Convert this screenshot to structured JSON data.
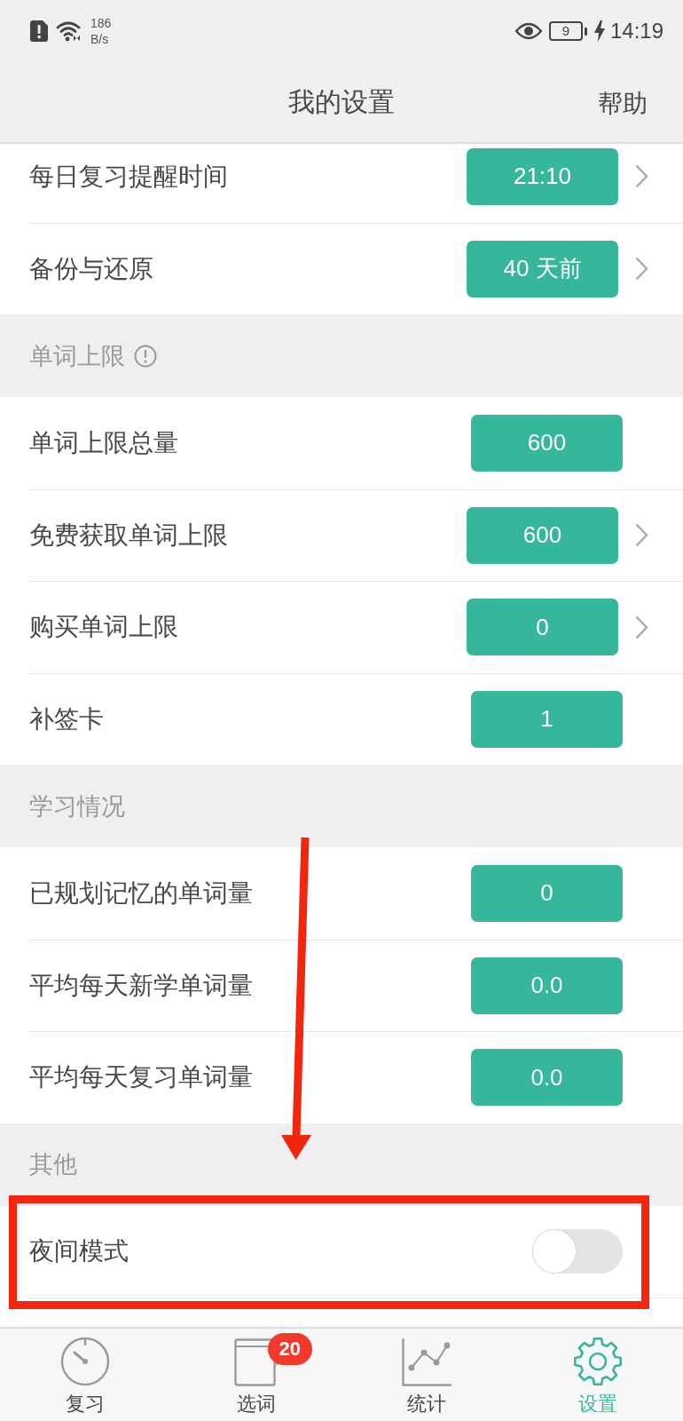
{
  "status_bar": {
    "net_speed": "186",
    "net_unit": "B/s",
    "battery": "9",
    "time": "14:19"
  },
  "header": {
    "title": "我的设置",
    "action": "帮助"
  },
  "sections": [
    {
      "rows": [
        {
          "kind": "value",
          "label": "每日复习提醒时间",
          "value": "21:10",
          "chevron": true
        },
        {
          "kind": "value",
          "label": "备份与还原",
          "value": "40 天前",
          "chevron": true
        }
      ]
    },
    {
      "title": "单词上限",
      "info": true,
      "rows": [
        {
          "kind": "value",
          "label": "单词上限总量",
          "value": "600",
          "chevron": false
        },
        {
          "kind": "value",
          "label": "免费获取单词上限",
          "value": "600",
          "chevron": true
        },
        {
          "kind": "value",
          "label": "购买单词上限",
          "value": "0",
          "chevron": true
        },
        {
          "kind": "value",
          "label": "补签卡",
          "value": "1",
          "chevron": false
        }
      ]
    },
    {
      "title": "学习情况",
      "info": false,
      "rows": [
        {
          "kind": "value",
          "label": "已规划记忆的单词量",
          "value": "0",
          "chevron": false
        },
        {
          "kind": "value",
          "label": "平均每天新学单词量",
          "value": "0.0",
          "chevron": false
        },
        {
          "kind": "value",
          "label": "平均每天复习单词量",
          "value": "0.0",
          "chevron": false
        }
      ]
    },
    {
      "title": "其他",
      "info": false,
      "rows": [
        {
          "kind": "toggle",
          "label": "夜间模式",
          "on": false
        }
      ]
    }
  ],
  "tab_bar": [
    {
      "label": "复习",
      "selected": false
    },
    {
      "label": "选词",
      "selected": false,
      "badge": "20"
    },
    {
      "label": "统计",
      "selected": false
    },
    {
      "label": "设置",
      "selected": true
    }
  ],
  "annotations": {
    "arrow": true,
    "highlight_frame": true
  }
}
